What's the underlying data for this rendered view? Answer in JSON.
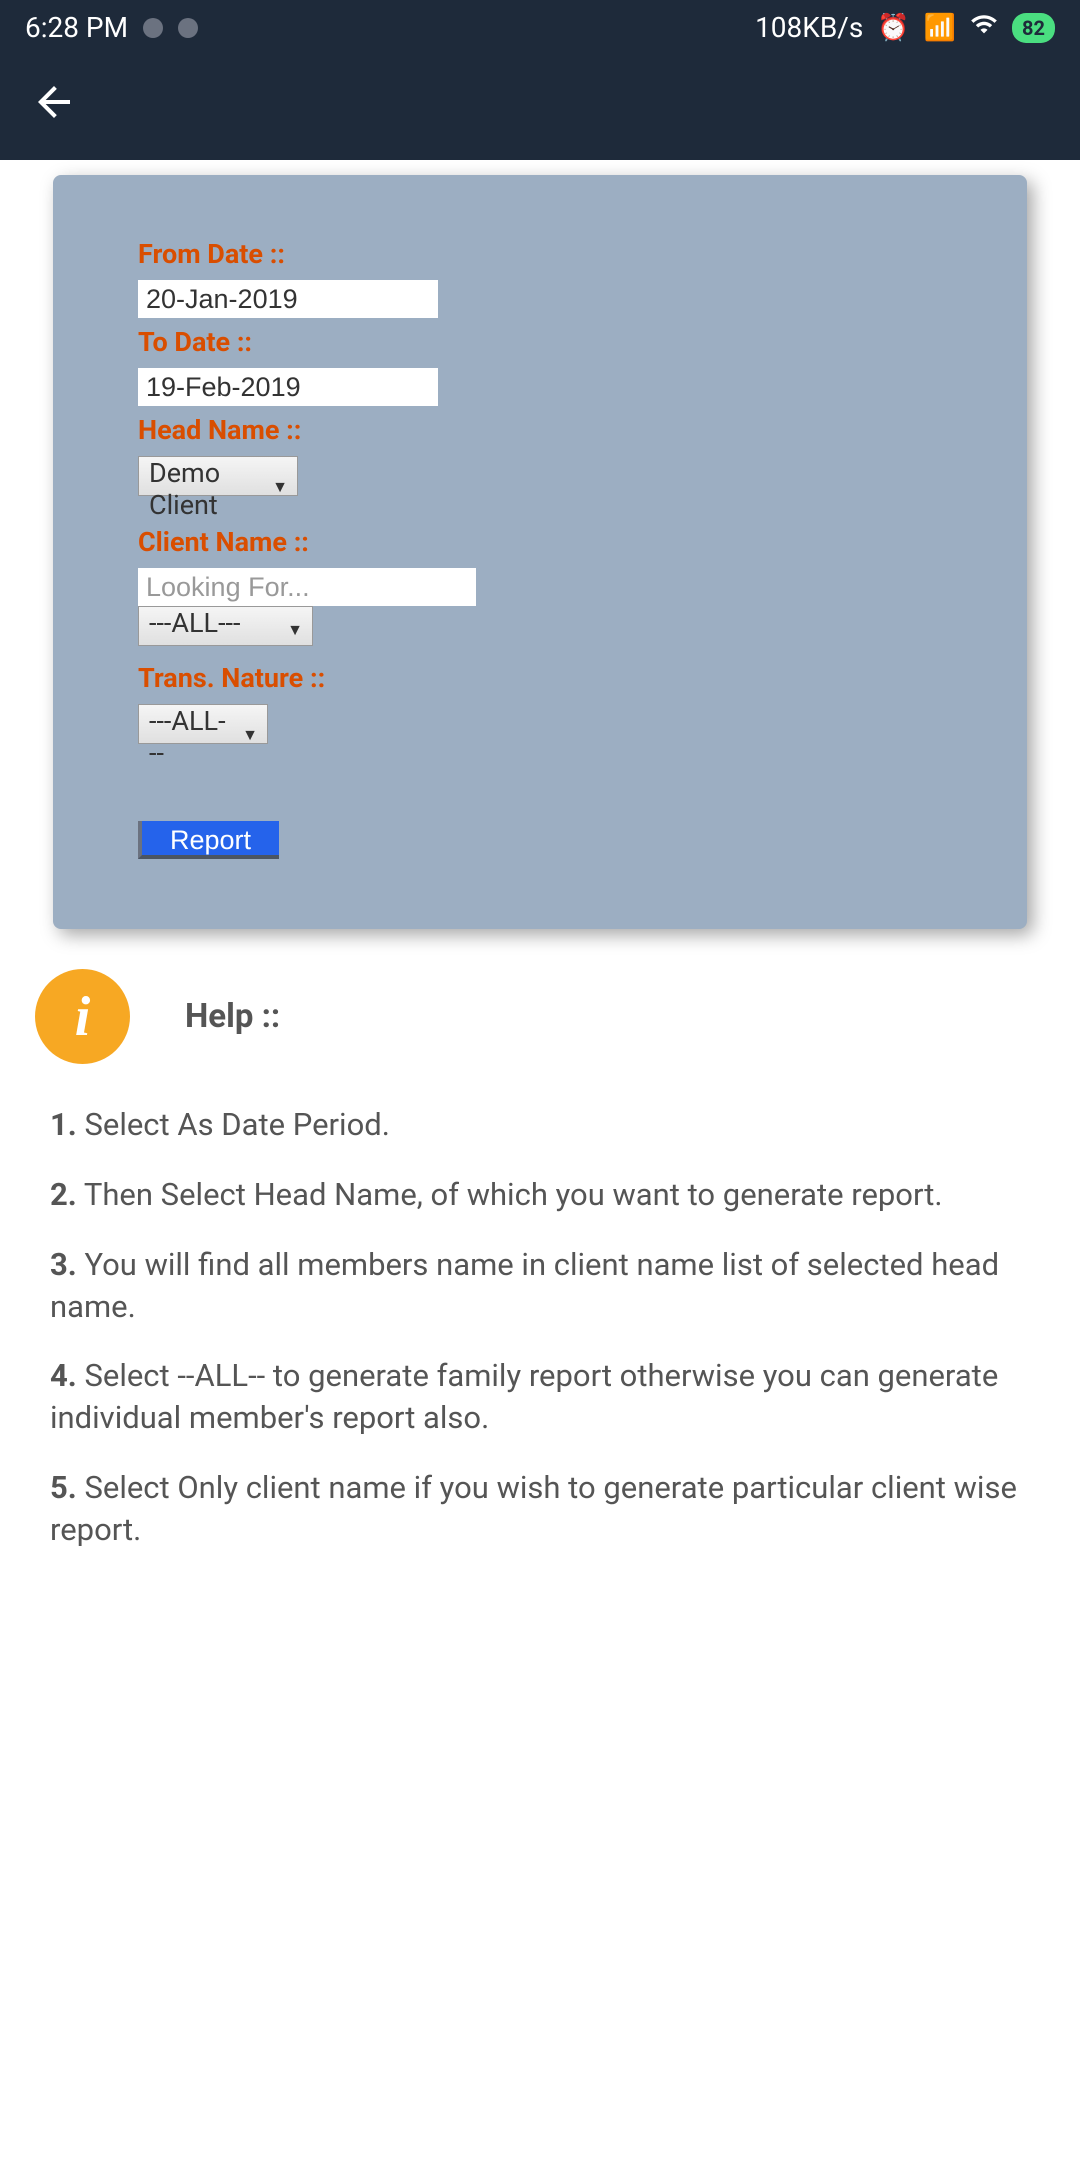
{
  "status_bar": {
    "time": "6:28 PM",
    "network_speed": "108KB/s",
    "battery": "82"
  },
  "form": {
    "from_date_label": "From Date ::",
    "from_date_value": "20-Jan-2019",
    "to_date_label": "To Date ::",
    "to_date_value": "19-Feb-2019",
    "head_name_label": "Head Name ::",
    "head_name_value": "Demo Client",
    "client_name_label": "Client Name ::",
    "client_name_placeholder": "Looking For...",
    "client_select_value": "---ALL---",
    "trans_nature_label": "Trans. Nature ::",
    "trans_nature_value": "---ALL---",
    "report_button": "Report"
  },
  "help": {
    "title": "Help ::",
    "items": [
      {
        "num": "1.",
        "text": " Select As Date Period."
      },
      {
        "num": "2.",
        "text": " Then Select Head Name, of which you want to generate report."
      },
      {
        "num": "3.",
        "text": " You will find all members name in client name list of selected head name."
      },
      {
        "num": "4.",
        "text": " Select --ALL-- to generate family report otherwise you can generate individual member's report also."
      },
      {
        "num": "5.",
        "text": " Select Only client name if you wish to generate particular client wise report."
      }
    ]
  }
}
